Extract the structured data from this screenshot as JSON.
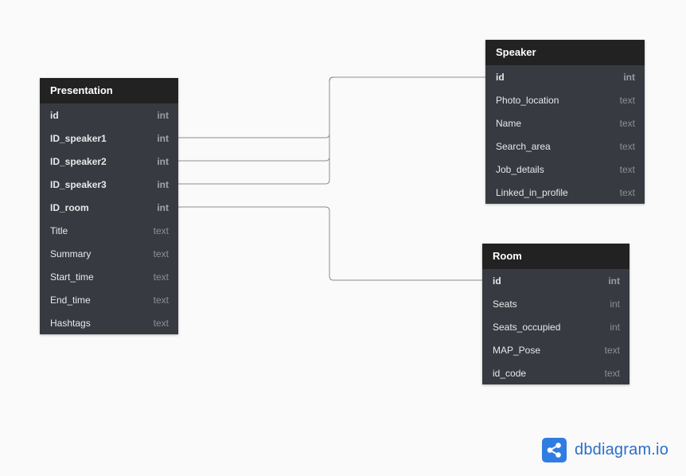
{
  "tables": {
    "presentation": {
      "name": "Presentation",
      "fields": [
        {
          "name": "id",
          "type": "int"
        },
        {
          "name": "ID_speaker1",
          "type": "int"
        },
        {
          "name": "ID_speaker2",
          "type": "int"
        },
        {
          "name": "ID_speaker3",
          "type": "int"
        },
        {
          "name": "ID_room",
          "type": "int"
        },
        {
          "name": "Title",
          "type": "text"
        },
        {
          "name": "Summary",
          "type": "text"
        },
        {
          "name": "Start_time",
          "type": "text"
        },
        {
          "name": "End_time",
          "type": "text"
        },
        {
          "name": "Hashtags",
          "type": "text"
        }
      ]
    },
    "speaker": {
      "name": "Speaker",
      "fields": [
        {
          "name": "id",
          "type": "int"
        },
        {
          "name": "Photo_location",
          "type": "text"
        },
        {
          "name": "Name",
          "type": "text"
        },
        {
          "name": "Search_area",
          "type": "text"
        },
        {
          "name": "Job_details",
          "type": "text"
        },
        {
          "name": "Linked_in_profile",
          "type": "text"
        }
      ]
    },
    "room": {
      "name": "Room",
      "fields": [
        {
          "name": "id",
          "type": "int"
        },
        {
          "name": "Seats",
          "type": "int"
        },
        {
          "name": "Seats_occupied",
          "type": "int"
        },
        {
          "name": "MAP_Pose",
          "type": "text"
        },
        {
          "name": "id_code",
          "type": "text"
        }
      ]
    }
  },
  "brand": {
    "text": "dbdiagram.io",
    "logo_icon": "share-nodes-icon"
  },
  "colors": {
    "background": "#fafafa",
    "table_body": "#383a42",
    "table_header": "#222222",
    "connector": "#8e8e8e",
    "brand_blue": "#2f7de1"
  }
}
